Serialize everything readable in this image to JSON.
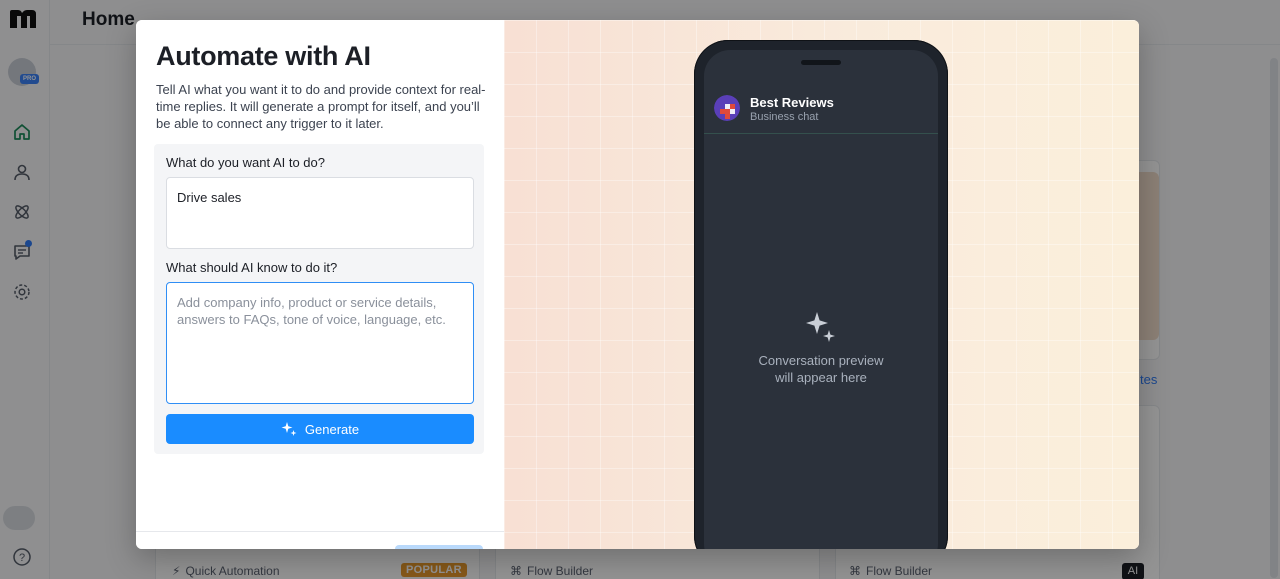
{
  "app": {
    "page_title": "Home",
    "pro_badge": "PRO",
    "sidebar_icons": [
      "home-icon",
      "contacts-icon",
      "automation-icon",
      "chat-icon",
      "settings-icon",
      "help-icon"
    ],
    "background": {
      "link_text": "tes",
      "footer_items": [
        {
          "label": "Quick Automation",
          "icon": "bolt-icon"
        },
        {
          "label": "Flow Builder",
          "icon": "flow-icon"
        },
        {
          "label": "Flow Builder",
          "icon": "flow-icon"
        }
      ],
      "popular_badge": "POPULAR",
      "ai_badge": "AI"
    }
  },
  "modal": {
    "title": "Automate with AI",
    "description": "Tell AI what you want it to do and provide context for real-time replies. It will generate a prompt for itself, and you’ll be able to connect any trigger to it later.",
    "goal": {
      "label": "What do you want AI to do?",
      "value": "Drive sales"
    },
    "context": {
      "label": "What should AI know to do it?",
      "value": "",
      "placeholder": "Add company info, product or service details, answers to FAQs, tone of voice, language, etc."
    },
    "generate_button": "Generate",
    "preview": {
      "chat_name": "Best Reviews",
      "chat_subtitle": "Business chat",
      "empty_line1": "Conversation preview",
      "empty_line2": "will appear here"
    }
  },
  "colors": {
    "accent": "#1a8cff",
    "popular": "#e89a2c",
    "phone": "#2b313b"
  }
}
